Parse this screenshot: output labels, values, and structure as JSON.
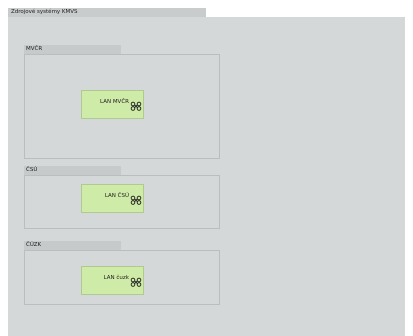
{
  "root": {
    "title": "Zdrojové systémy KMVS"
  },
  "groups": [
    {
      "label": "MVČR",
      "node_label": "LAN MVČR",
      "node_icon": "network-icon"
    },
    {
      "label": "ČSÚ",
      "node_label": "LAN ČSÚ",
      "node_icon": "network-icon"
    },
    {
      "label": "ČÚZK",
      "node_label": "LAN čuzk",
      "node_icon": "network-icon"
    }
  ],
  "colors": {
    "background": "#d4d8d8",
    "tab": "#c6caca",
    "node_fill": "#cfeba8",
    "node_border": "#b0c98e",
    "icon_stroke": "#1a1a1a"
  }
}
